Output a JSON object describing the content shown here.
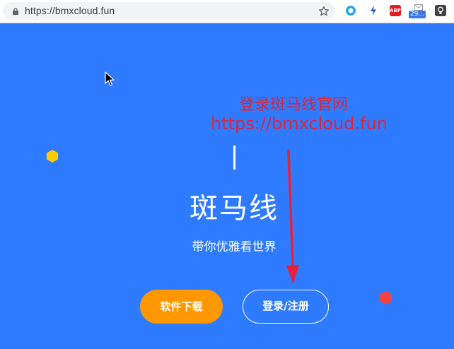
{
  "browser": {
    "url": "https://bmxcloud.fun",
    "extensions": {
      "abp_label": "ABP",
      "mail_badge": "29..."
    }
  },
  "annotation": {
    "title": "登录斑马线官网",
    "url": "https://bmxcloud.fun",
    "color": "#d7263d"
  },
  "hero": {
    "title": "斑马线",
    "subtitle": "带你优雅看世界"
  },
  "buttons": {
    "download": "软件下载",
    "login": "登录/注册"
  },
  "colors": {
    "background": "#2f7bff",
    "download_button": "#ff9800",
    "deco_yellow": "#ffcc00",
    "deco_red": "#f4433c"
  },
  "icons": [
    "lock-icon",
    "star-icon",
    "refresh-extension-icon",
    "bolt-extension-icon",
    "adblock-icon",
    "mail-extension-icon",
    "bulb-extension-icon",
    "mouse-pointer-icon",
    "down-arrow-icon"
  ]
}
